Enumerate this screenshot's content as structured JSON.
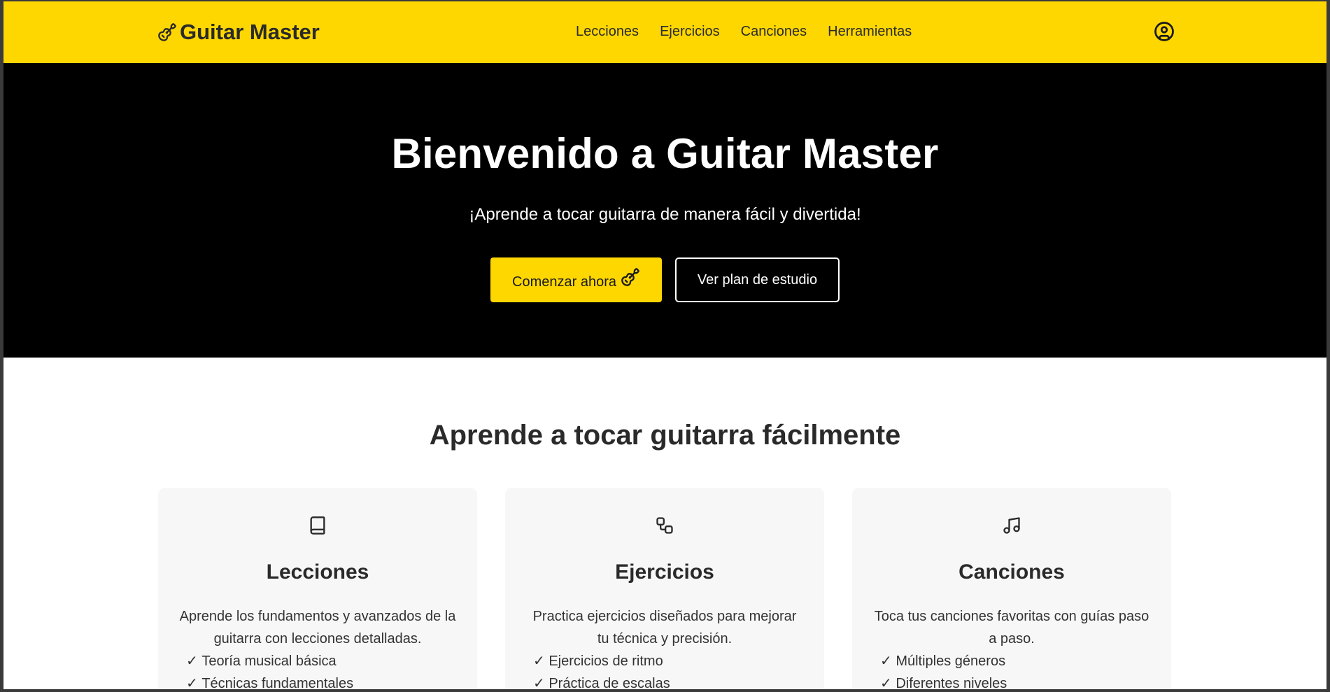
{
  "header": {
    "logo_text": "Guitar Master",
    "logo_icon": "guitar-icon",
    "nav": [
      "Lecciones",
      "Ejercicios",
      "Canciones",
      "Herramientas"
    ],
    "account_icon": "user-circle-icon",
    "background_color": "#FFD700"
  },
  "hero": {
    "title": "Bienvenido a Guitar Master",
    "subtitle": "¡Aprende a tocar guitarra de manera fácil y divertida!",
    "primary_button": "Comenzar ahora",
    "primary_button_icon": "guitar-icon",
    "secondary_button": "Ver plan de estudio",
    "background_color": "#000000"
  },
  "features": {
    "title": "Aprende a tocar guitarra fácilmente",
    "cards": [
      {
        "icon": "book-icon",
        "title": "Lecciones",
        "description": "Aprende los fundamentos y avanzados de la guitarra con lecciones detalladas.",
        "items": [
          "Teoría musical básica",
          "Técnicas fundamentales"
        ]
      },
      {
        "icon": "workflow-icon",
        "title": "Ejercicios",
        "description": "Practica ejercicios diseñados para mejorar tu técnica y precisión.",
        "items": [
          "Ejercicios de ritmo",
          "Práctica de escalas"
        ]
      },
      {
        "icon": "music-note-icon",
        "title": "Canciones",
        "description": "Toca tus canciones favoritas con guías paso a paso.",
        "items": [
          "Múltiples géneros",
          "Diferentes niveles"
        ]
      }
    ]
  }
}
